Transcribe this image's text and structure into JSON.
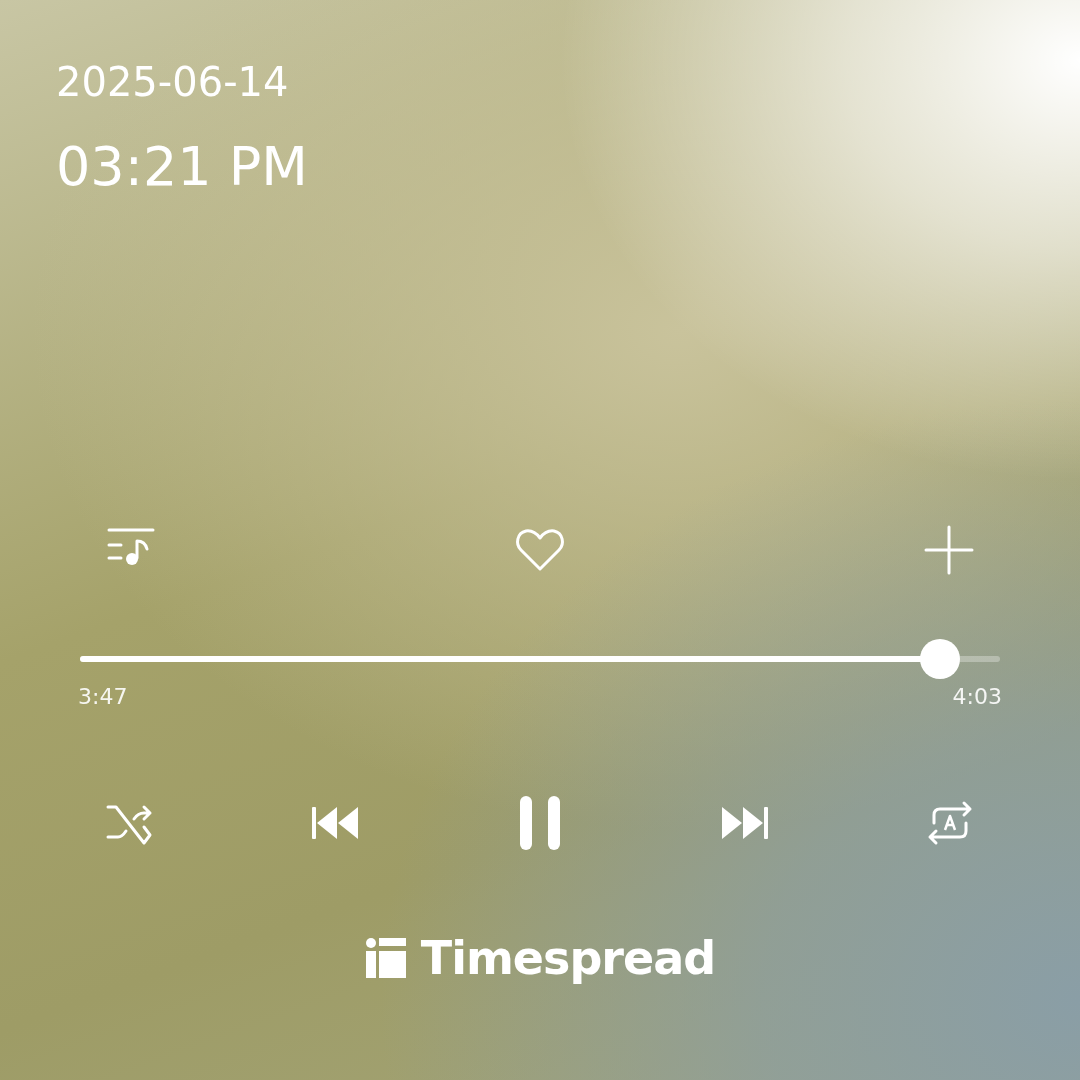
{
  "date": "2025-06-14",
  "time": "03:21 PM",
  "actions": [
    {
      "kind": "queue"
    },
    {
      "kind": "like"
    },
    {
      "kind": "add"
    }
  ],
  "progress": {
    "level": 0.935,
    "elapsed": "3:47",
    "total": "4:03"
  },
  "controls": [
    {
      "kind": "shuffle"
    },
    {
      "kind": "previous"
    },
    {
      "kind": "pause"
    },
    {
      "kind": "next"
    },
    {
      "kind": "repeat"
    }
  ],
  "brand": {
    "name": "Timespread"
  }
}
